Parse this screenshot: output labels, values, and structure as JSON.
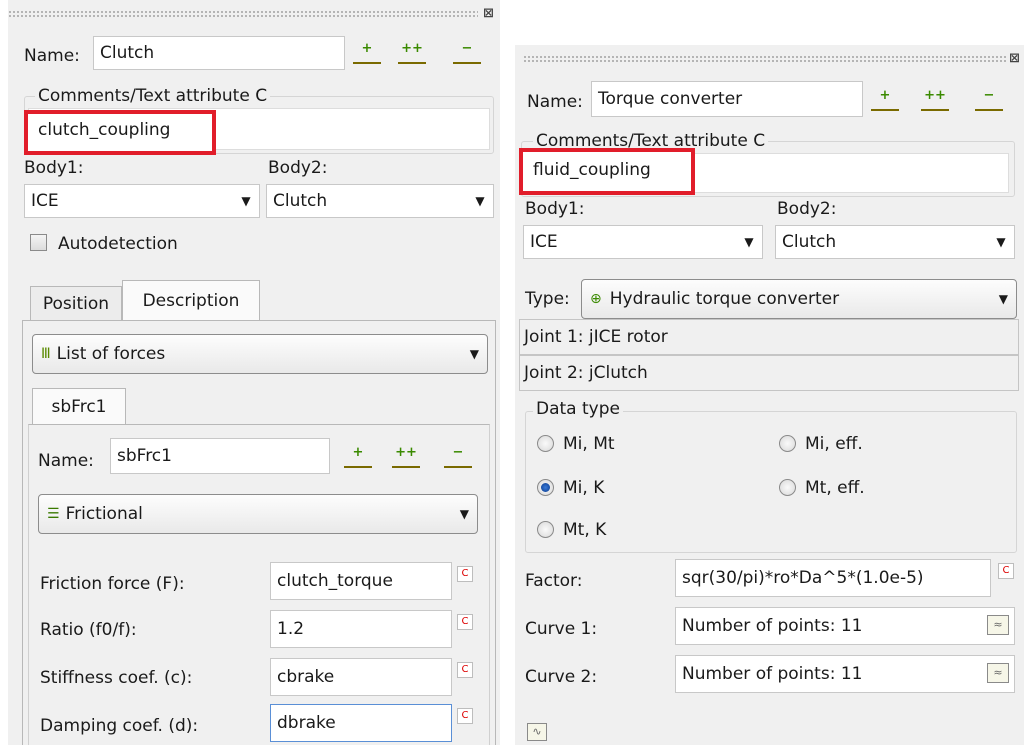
{
  "left": {
    "name_label": "Name:",
    "name_value": "Clutch",
    "comments_legend": "Comments/Text attribute C",
    "comments_value": "clutch_coupling",
    "body1_label": "Body1:",
    "body1_value": "ICE",
    "body2_label": "Body2:",
    "body2_value": "Clutch",
    "autodetection_label": "Autodetection",
    "tabs": [
      "Position",
      "Description"
    ],
    "forces_combo": "List of forces",
    "subtab": "sbFrc1",
    "sub_name_label": "Name:",
    "sub_name_value": "sbFrc1",
    "force_type": "Frictional",
    "params": [
      {
        "label": "Friction force (F):",
        "value": "clutch_torque"
      },
      {
        "label": "Ratio (f0/f):",
        "value": "1.2"
      },
      {
        "label": "Stiffness coef. (c):",
        "value": "cbrake"
      },
      {
        "label": "Damping coef. (d):",
        "value": "dbrake"
      }
    ]
  },
  "right": {
    "name_label": "Name:",
    "name_value": "Torque converter",
    "comments_legend": "Comments/Text attribute C",
    "comments_value": "fluid_coupling",
    "body1_label": "Body1:",
    "body1_value": "ICE",
    "body2_label": "Body2:",
    "body2_value": "Clutch",
    "type_label": "Type:",
    "type_value": "Hydraulic torque converter",
    "joint1": "Joint 1: jICE rotor",
    "joint2": "Joint 2: jClutch",
    "datatype_legend": "Data type",
    "radios": [
      {
        "label": "Mi, Mt",
        "selected": false
      },
      {
        "label": "Mi, eff.",
        "selected": false
      },
      {
        "label": "Mi, K",
        "selected": true
      },
      {
        "label": "Mt, eff.",
        "selected": false
      },
      {
        "label": "Mt, K",
        "selected": false
      }
    ],
    "factor_label": "Factor:",
    "factor_value": "sqr(30/pi)*ro*Da^5*(1.0e-5)",
    "curve1_label": "Curve 1:",
    "curve1_value": "Number of points: 11",
    "curve2_label": "Curve 2:",
    "curve2_value": "Number of points: 11"
  },
  "c_marker": "C",
  "icons": [
    "add-element-icon",
    "add-copy-icon",
    "remove-element-icon",
    "close-icon",
    "dropdown-arrow-icon",
    "forces-list-icon",
    "frictional-icon",
    "hydraulic-icon",
    "curve-editor-icon",
    "graph-icon"
  ],
  "colors": {
    "panel_bg": "#f0f0f0",
    "highlight_red": "#e11d2a",
    "c_marker_red": "#dd0000"
  }
}
